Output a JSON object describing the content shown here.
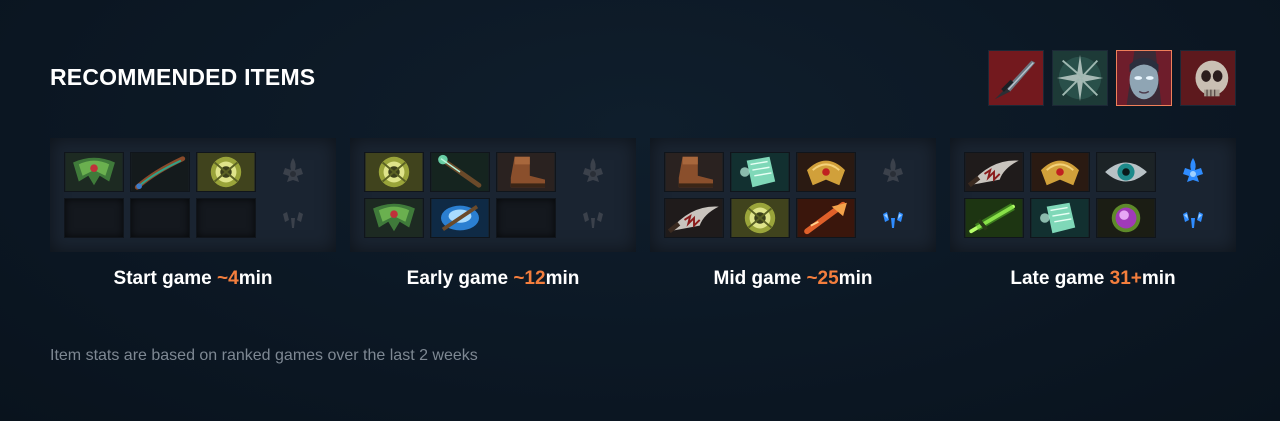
{
  "header": {
    "title": "RECOMMENDED ITEMS"
  },
  "hero_tabs": [
    {
      "icon": "dagger-icon",
      "active": false
    },
    {
      "icon": "burst-icon",
      "active": false
    },
    {
      "icon": "hero-portrait-icon",
      "active": true
    },
    {
      "icon": "skull-icon",
      "active": false
    }
  ],
  "phases": [
    {
      "label": "Start game ",
      "time": "~4",
      "unit": "min",
      "items": [
        "helm-icon",
        "branch-icon",
        "orb-icon",
        "empty",
        "empty",
        "empty"
      ],
      "shards": [
        "scepter-inactive-icon",
        "shard-inactive-icon"
      ]
    },
    {
      "label": "Early game ",
      "time": "~12",
      "unit": "min",
      "items": [
        "orb-icon",
        "wand-icon",
        "boots-icon",
        "helm-icon",
        "orb-blue-icon",
        "empty"
      ],
      "shards": [
        "scepter-inactive-icon",
        "shard-inactive-icon"
      ]
    },
    {
      "label": "Mid game ",
      "time": "~25",
      "unit": "min",
      "items": [
        "boots-icon",
        "book-icon",
        "mask-gold-icon",
        "blade-icon",
        "orb-icon",
        "axe-orange-icon"
      ],
      "shards": [
        "scepter-inactive-icon",
        "shard-active-icon"
      ]
    },
    {
      "label": "Late game ",
      "time": "31+",
      "unit": "min",
      "items": [
        "blade-icon",
        "mask-gold-icon",
        "eye-icon",
        "sword-green-icon",
        "book-icon",
        "orb-purple-icon"
      ],
      "shards": [
        "scepter-active-icon",
        "shard-active-icon"
      ]
    }
  ],
  "footer": {
    "note": "Item stats are based on ranked games over the last 2 weeks"
  },
  "colors": {
    "accent": "#f47e3d",
    "background": "#0b1723",
    "panel": "#1a2431"
  }
}
